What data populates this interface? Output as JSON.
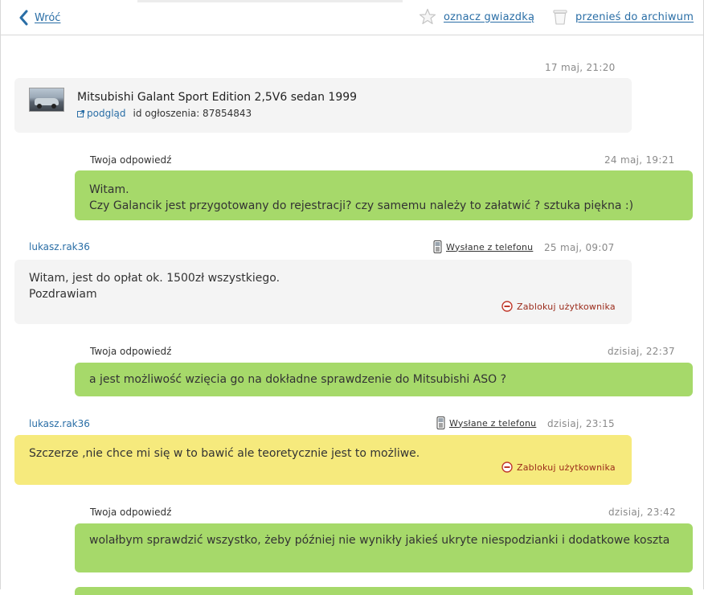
{
  "nav": {
    "back_label": "Wróć",
    "star_label": "oznacz gwiazdką",
    "archive_label": "przenieś do archiwum"
  },
  "listing": {
    "timestamp": "17 maj, 21:20",
    "title": "Mitsubishi Galant Sport Edition 2,5V6 sedan 1999",
    "preview_label": "podgląd",
    "ad_id_label": "id ogłoszenia: 87854843"
  },
  "messages": [
    {
      "sender": "Twoja odpowiedź",
      "timestamp": "24 maj, 19:21",
      "text": "Witam.\nCzy Galancik jest przygotowany do rejestracji? czy samemu należy to załatwić ? sztuka piękna :)"
    },
    {
      "sender": "lukasz.rak36",
      "sent_from": "Wysłane z telefonu",
      "timestamp": "25 maj, 09:07",
      "text": "Witam, jest do opłat ok. 1500zł wszystkiego.\nPozdrawiam",
      "block_label": "Zablokuj użytkownika"
    },
    {
      "sender": "Twoja odpowiedź",
      "timestamp": "dzisiaj, 22:37",
      "text": "a jest możliwość wzięcia go na dokładne sprawdzenie do Mitsubishi ASO ?"
    },
    {
      "sender": "lukasz.rak36",
      "sent_from": "Wysłane z telefonu",
      "timestamp": "dzisiaj, 23:15",
      "text": "Szczerze ,nie chce mi się w to bawić ale teoretycznie jest to możliwe.",
      "block_label": "Zablokuj użytkownika"
    },
    {
      "sender": "Twoja odpowiedź",
      "timestamp": "dzisiaj, 23:42",
      "text": "wolałbym sprawdzić wszystko, żeby później nie wynikły jakieś ukryte niespodzianki i dodatkowe koszta"
    }
  ],
  "colors": {
    "link": "#2a6ea6",
    "own_message": "#a6d96a",
    "highlighted_message": "#f6ea7d",
    "received_message": "#f4f4f4",
    "block_red": "#c0392b"
  }
}
